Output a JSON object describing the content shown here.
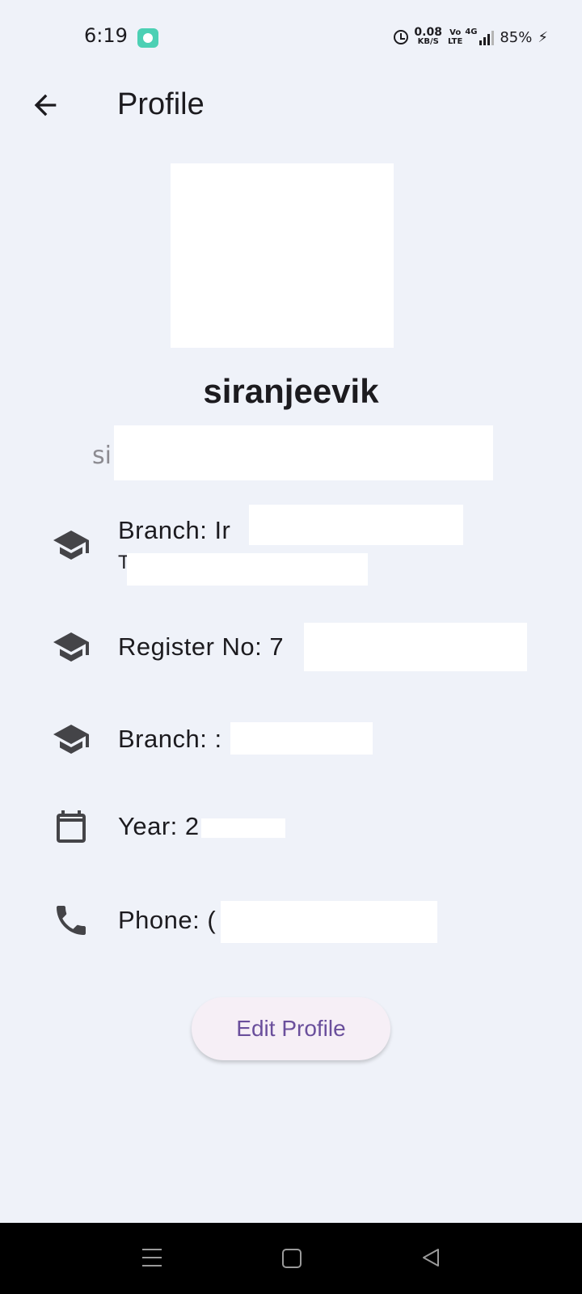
{
  "status_bar": {
    "time": "6:19",
    "net_speed_value": "0.08",
    "net_speed_unit": "KB/S",
    "volte_line1": "Vo",
    "volte_line2": "LTE",
    "network": "4G",
    "battery": "85%"
  },
  "app_bar": {
    "title": "Profile",
    "back_icon": "arrow-back-icon"
  },
  "profile": {
    "username": "siranjeevik",
    "email_prefix": "si",
    "branch_prefix": "Branch: Ir",
    "branch_second_line": "T",
    "register_no": "Register No: 7",
    "branch2": "Branch: :",
    "year": "Year: 2",
    "phone": "Phone: ("
  },
  "icons": {
    "branch": "school-icon",
    "register": "school-icon",
    "branch2": "school-icon",
    "year": "calendar-icon",
    "phone": "phone-icon"
  },
  "actions": {
    "edit_label": "Edit Profile"
  },
  "colors": {
    "background": "#eff2f9",
    "accent": "#6a4f9c",
    "button_bg": "#f6eff6",
    "icon": "#444448"
  }
}
